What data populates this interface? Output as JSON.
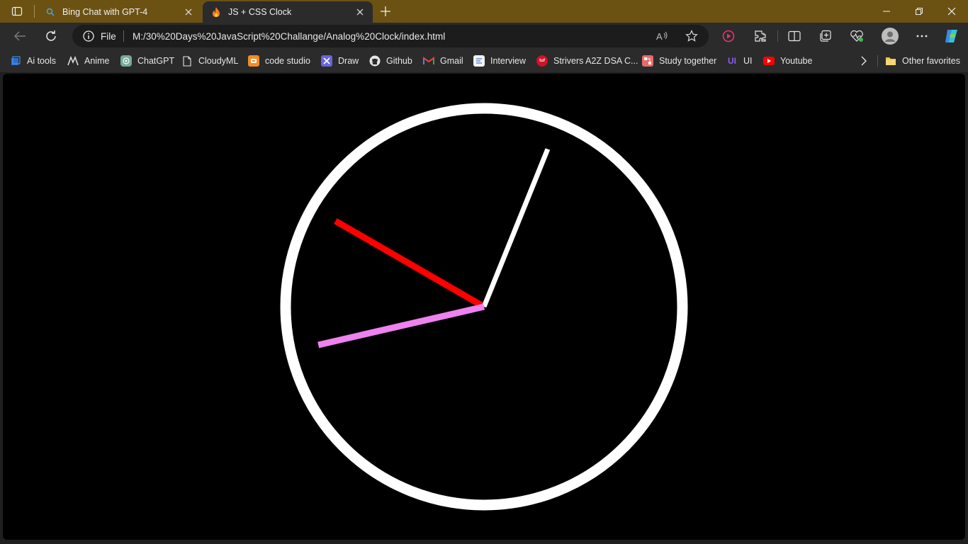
{
  "tabs": [
    {
      "title": "Bing Chat with GPT-4",
      "active": false,
      "icon": "bing-search-icon"
    },
    {
      "title": "JS + CSS Clock",
      "active": true,
      "icon": "fire-icon"
    }
  ],
  "address": {
    "label": "File",
    "url": "M:/30%20Days%20JavaScript%20Challange/Analog%20Clock/index.html"
  },
  "bookmarks": [
    {
      "label": "Ai tools",
      "icon": "folder-icon"
    },
    {
      "label": "Anime",
      "icon": "anime-icon"
    },
    {
      "label": "ChatGPT",
      "icon": "chatgpt-icon"
    },
    {
      "label": "CloudyML",
      "icon": "page-icon"
    },
    {
      "label": "code studio",
      "icon": "codestudio-icon"
    },
    {
      "label": "Draw",
      "icon": "draw-icon"
    },
    {
      "label": "Github",
      "icon": "github-icon"
    },
    {
      "label": "Gmail",
      "icon": "gmail-icon"
    },
    {
      "label": "Interview",
      "icon": "interview-icon"
    },
    {
      "label": "Strivers A2Z DSA C...",
      "icon": "tuf-icon"
    },
    {
      "label": "Study together",
      "icon": "study-icon"
    },
    {
      "label": "UI",
      "icon": "ui-icon"
    },
    {
      "label": "Youtube",
      "icon": "youtube-icon"
    }
  ],
  "other_favorites": "Other favorites",
  "clock": {
    "face_color": "#000000",
    "ring_color": "#ffffff",
    "hour_hand": {
      "angle_deg": 300,
      "color": "#ff0000"
    },
    "minute_hand": {
      "angle_deg": 22,
      "color": "#ffffff"
    },
    "second_hand": {
      "angle_deg": 257,
      "color": "#ee82ee"
    }
  },
  "colors": {
    "titlebar": "#6b5213",
    "toolbar": "#2b2b2b"
  }
}
